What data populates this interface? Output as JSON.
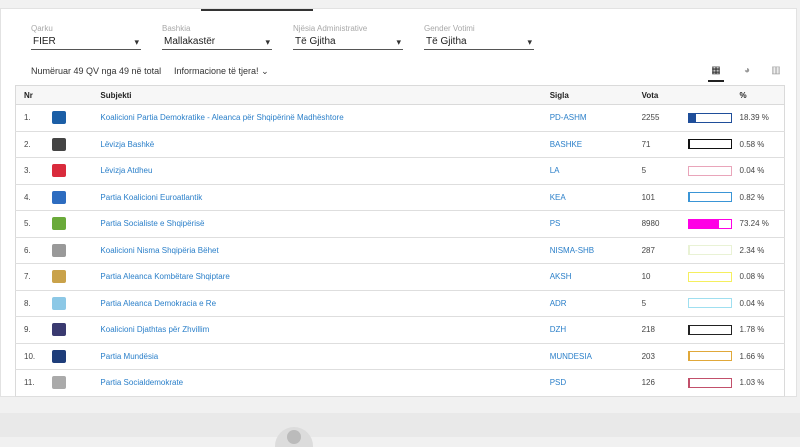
{
  "filters": [
    {
      "label": "Qarku",
      "value": "FIER"
    },
    {
      "label": "Bashkia",
      "value": "Mallakastër"
    },
    {
      "label": "Njësia Administrative",
      "value": "Të Gjitha"
    },
    {
      "label": "Gender Votimi",
      "value": "Të Gjitha"
    }
  ],
  "meta": {
    "counted": "Numëruar 49 QV nga 49 në total",
    "more": "Informacione të tjera!",
    "more_chevron": "⌄"
  },
  "views": {
    "table_icon": "table-icon",
    "pie_icon": "pie-chart-icon",
    "bar_icon": "bar-chart-icon",
    "table_glyph": "▦",
    "pie_glyph": "◕",
    "bar_glyph": "▥"
  },
  "table": {
    "headers": {
      "nr": "Nr",
      "subjekti": "Subjekti",
      "sigla": "Sigla",
      "vota": "Vota",
      "pct": "%"
    },
    "rows": [
      {
        "nr": "1.",
        "subjekti": "Koalicioni Partia Demokratike - Aleanca për Shqipërinë Madhështore",
        "sigla": "PD-ASHM",
        "vota": "2255",
        "pct": "18.39 %",
        "frac": 0.1839,
        "color": "#1f4e9a",
        "logo": "#1b5ea6"
      },
      {
        "nr": "2.",
        "subjekti": "Lëvizja Bashkë",
        "sigla": "BASHKE",
        "vota": "71",
        "pct": "0.58 %",
        "frac": 0.0058,
        "color": "#111111",
        "logo": "#444444"
      },
      {
        "nr": "3.",
        "subjekti": "Lëvizja Atdheu",
        "sigla": "LA",
        "vota": "5",
        "pct": "0.04 %",
        "frac": 0.0004,
        "color": "#e9a5ba",
        "logo": "#d92b3c"
      },
      {
        "nr": "4.",
        "subjekti": "Partia Koalicioni Euroatlantik",
        "sigla": "KEA",
        "vota": "101",
        "pct": "0.82 %",
        "frac": 0.0082,
        "color": "#3a95d6",
        "logo": "#2d6cc0"
      },
      {
        "nr": "5.",
        "subjekti": "Partia Socialiste e Shqipërisë",
        "sigla": "PS",
        "vota": "8980",
        "pct": "73.24 %",
        "frac": 0.7324,
        "color": "#ff00e5",
        "logo": "#6aaa3a"
      },
      {
        "nr": "6.",
        "subjekti": "Koalicioni Nisma Shqipëria Bëhet",
        "sigla": "NISMA-SHB",
        "vota": "287",
        "pct": "2.34 %",
        "frac": 0.0234,
        "color": "#e9f2d5",
        "logo": "#999999"
      },
      {
        "nr": "7.",
        "subjekti": "Partia Aleanca Kombëtare Shqiptare",
        "sigla": "AKSH",
        "vota": "10",
        "pct": "0.08 %",
        "frac": 0.0008,
        "color": "#f5ef5e",
        "logo": "#c9a24a"
      },
      {
        "nr": "8.",
        "subjekti": "Partia Aleanca Demokracia e Re",
        "sigla": "ADR",
        "vota": "5",
        "pct": "0.04 %",
        "frac": 0.0004,
        "color": "#9fdff0",
        "logo": "#8cc8e6"
      },
      {
        "nr": "9.",
        "subjekti": "Koalicioni Djathtas për Zhvillim",
        "sigla": "DZH",
        "vota": "218",
        "pct": "1.78 %",
        "frac": 0.0178,
        "color": "#222222",
        "logo": "#3a3a70"
      },
      {
        "nr": "10.",
        "subjekti": "Partia Mundësia",
        "sigla": "MUNDESIA",
        "vota": "203",
        "pct": "1.66 %",
        "frac": 0.0166,
        "color": "#e0a83a",
        "logo": "#1e3d7a"
      },
      {
        "nr": "11.",
        "subjekti": "Partia Socialdemokrate",
        "sigla": "PSD",
        "vota": "126",
        "pct": "1.03 %",
        "frac": 0.0103,
        "color": "#c2506b",
        "logo": "#aaaaaa"
      }
    ]
  }
}
